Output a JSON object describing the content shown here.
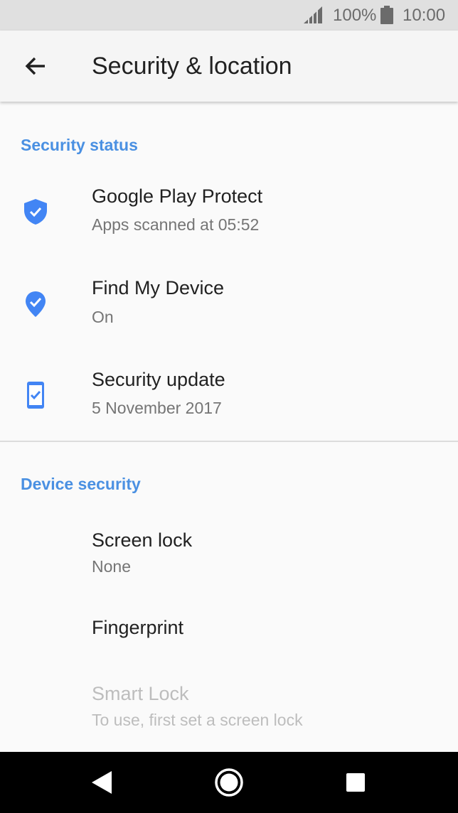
{
  "status_bar": {
    "battery_level": "100%",
    "time": "10:00",
    "signal_icon": "signal-icon",
    "battery_icon": "battery-full-icon"
  },
  "app_bar": {
    "title": "Security & location",
    "back_icon": "arrow-back-icon"
  },
  "sections": [
    {
      "header": "Security status",
      "items": [
        {
          "title": "Google Play Protect",
          "summary": "Apps scanned at 05:52",
          "icon": "shield-check-icon"
        },
        {
          "title": "Find My Device",
          "summary": "On",
          "icon": "location-check-icon"
        },
        {
          "title": "Security update",
          "summary": "5 November 2017",
          "icon": "phone-check-icon"
        }
      ]
    },
    {
      "header": "Device security",
      "items": [
        {
          "title": "Screen lock",
          "summary": "None"
        },
        {
          "title": "Fingerprint"
        },
        {
          "title": "Smart Lock",
          "summary": "To use, first set a screen lock",
          "disabled": true
        }
      ]
    }
  ],
  "nav_bar": {
    "back_icon": "nav-back-icon",
    "home_icon": "nav-home-icon",
    "recents_icon": "nav-recents-icon"
  },
  "colors": {
    "accent": "#4a90e2",
    "icon_blue": "#4285f4",
    "status_bar_bg": "#e0e0e0",
    "app_bar_bg": "#f5f5f5",
    "background": "#fafafa",
    "nav_bar_bg": "#000000",
    "disabled_text": "#bdbdbd"
  }
}
